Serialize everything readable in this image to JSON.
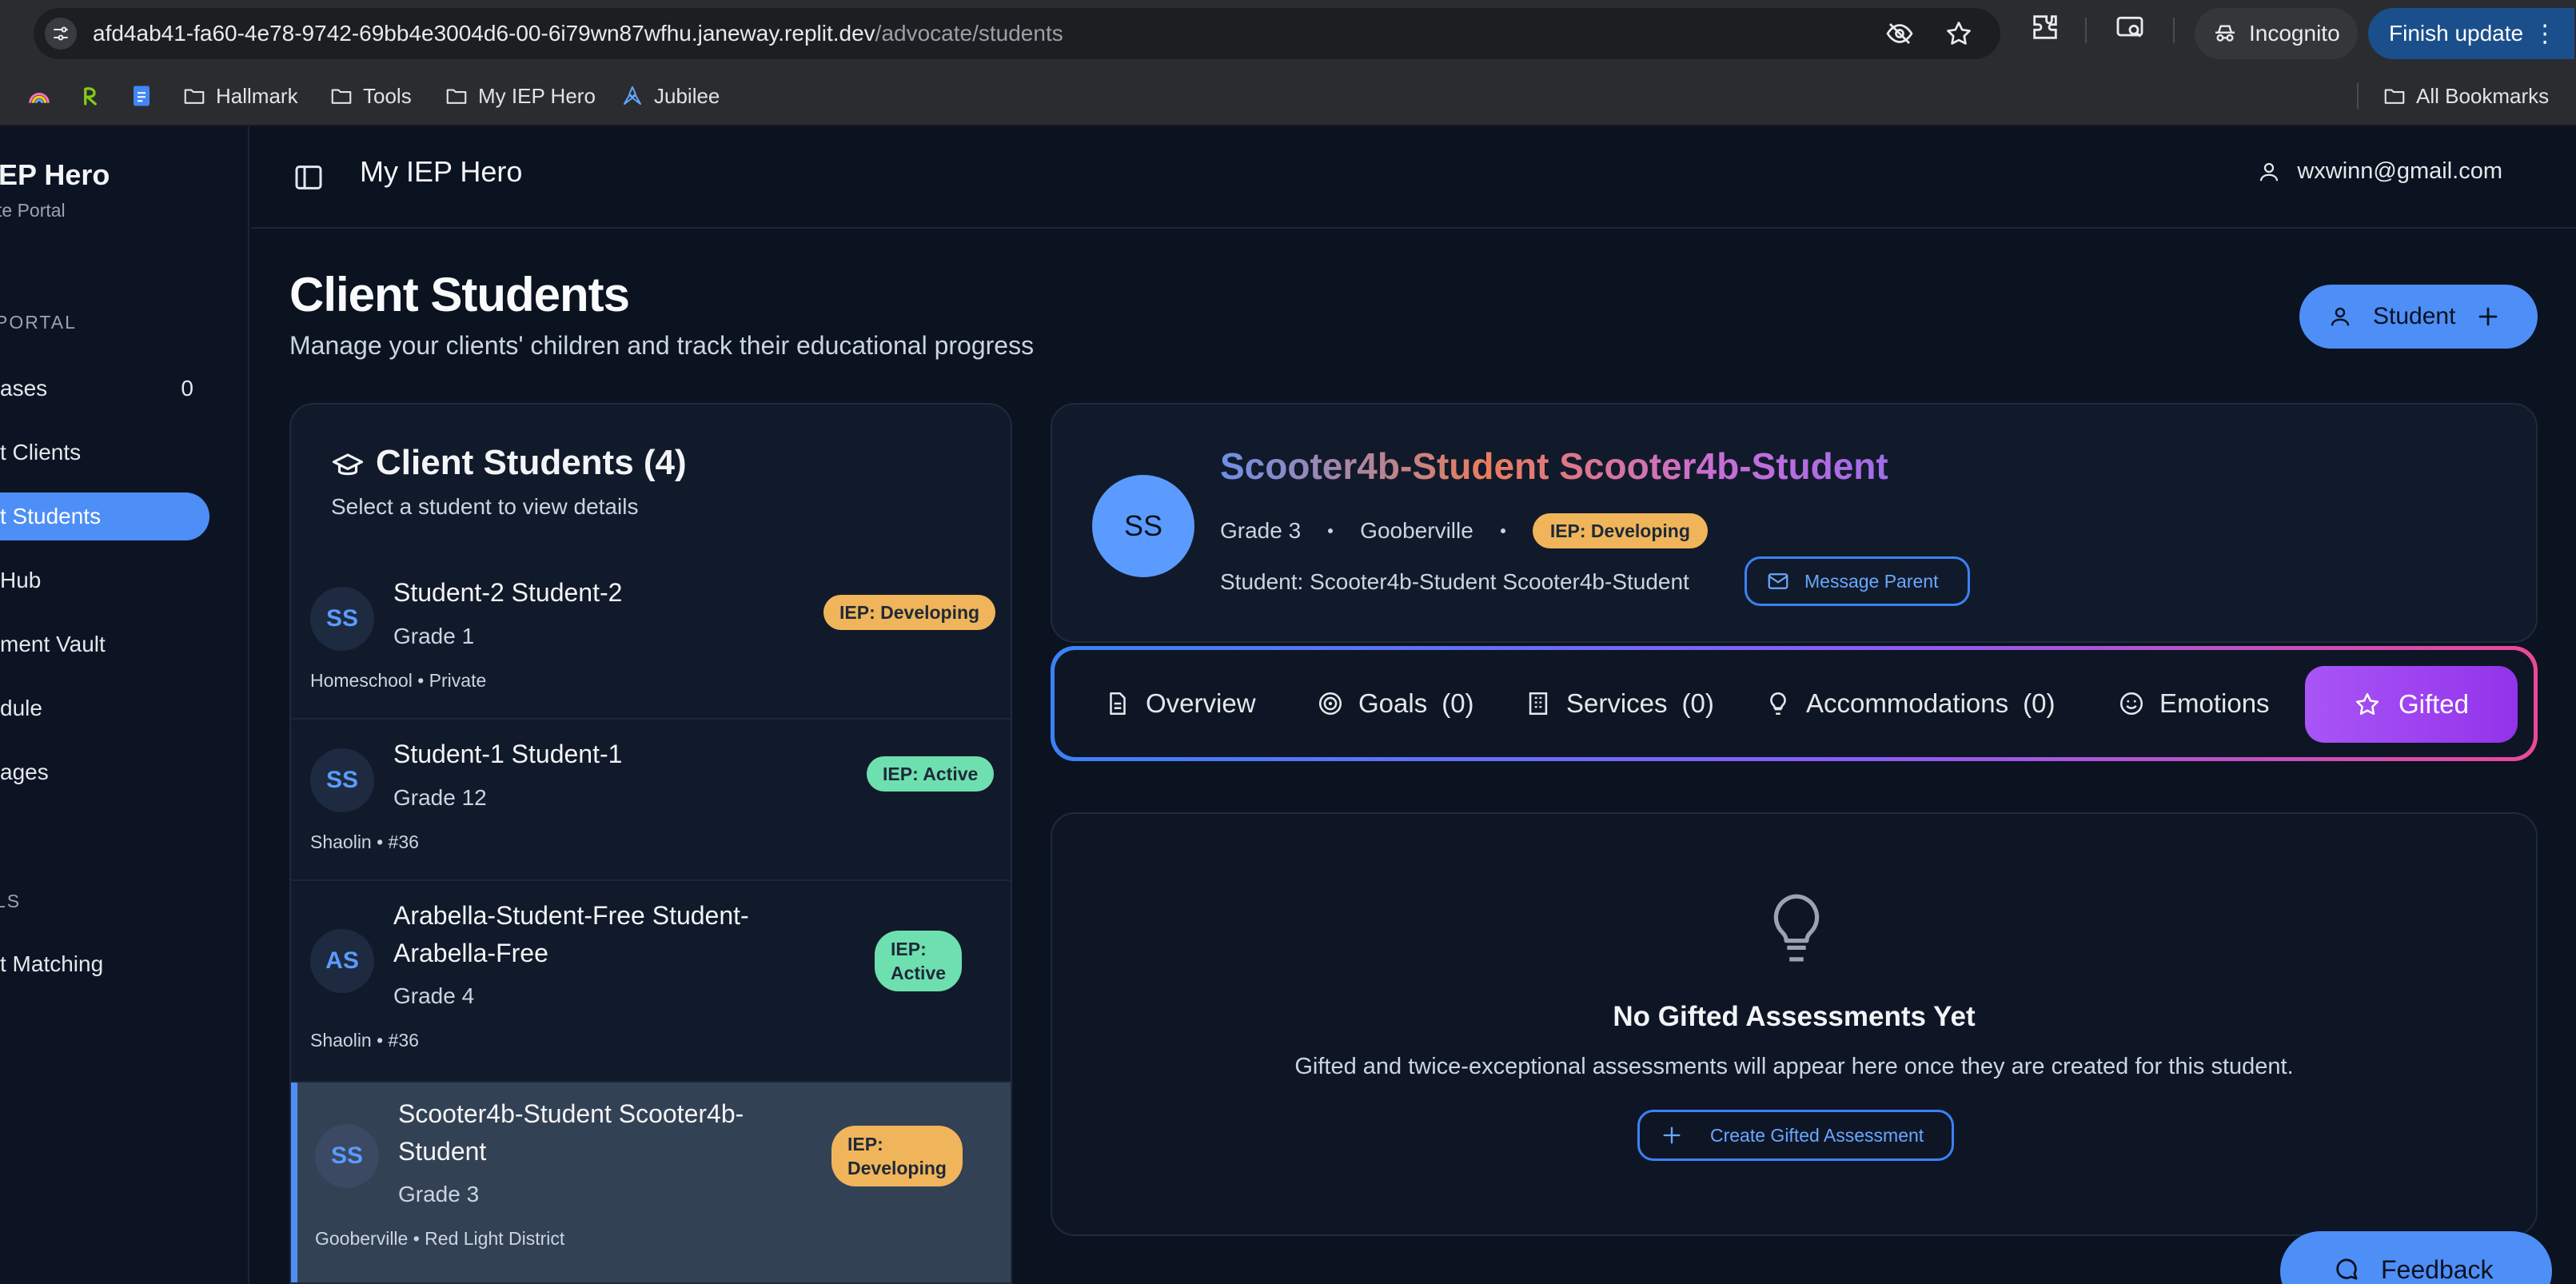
{
  "browser": {
    "url_host": "afd4ab41-fa60-4e78-9742-69bb4e3004d6-00-6i79wn87wfhu.janeway.replit.dev",
    "url_path": "/advocate/students",
    "incognito_label": "Incognito",
    "finish_update_label": "Finish update",
    "bookmarks": [
      "Hallmark",
      "Tools",
      "My IEP Hero",
      "Jubilee"
    ],
    "all_bookmarks_label": "All Bookmarks"
  },
  "sidebar": {
    "brand_title": "IEP Hero",
    "brand_subtitle": "te Portal",
    "section_portal": "PORTAL",
    "section_tools": "LS",
    "items": [
      {
        "label": "ases",
        "count": "0"
      },
      {
        "label": "t Clients"
      },
      {
        "label": "t Students"
      },
      {
        "label": " Hub"
      },
      {
        "label": "ment Vault"
      },
      {
        "label": "dule"
      },
      {
        "label": "ages"
      },
      {
        "label": "t Matching"
      }
    ]
  },
  "header": {
    "title": "My IEP Hero",
    "user_email": "wxwinn@gmail.com"
  },
  "page": {
    "title": "Client Students",
    "subtitle": "Manage your clients' children and track their educational progress",
    "add_student_label": "Student"
  },
  "student_list": {
    "title": "Client Students (4)",
    "subtitle": "Select a student to view details",
    "students": [
      {
        "initials": "SS",
        "name": "Student-2 Student-2",
        "grade": "Grade 1",
        "meta": "Homeschool • Private",
        "badge": "IEP: Developing",
        "badge_color": "#f0b55a"
      },
      {
        "initials": "SS",
        "name": "Student-1 Student-1",
        "grade": "Grade 12",
        "meta": "Shaolin • #36",
        "badge": "IEP: Active",
        "badge_color": "#6ee0b0"
      },
      {
        "initials": "AS",
        "name_line1": "Arabella-Student-Free Student-",
        "name_line2": "Arabella-Free",
        "grade": "Grade 4",
        "meta": "Shaolin • #36",
        "badge_line1": "IEP:",
        "badge_line2": "Active",
        "badge_color": "#6ee0b0"
      },
      {
        "initials": "SS",
        "name_line1": "Scooter4b-Student Scooter4b-",
        "name_line2": "Student",
        "grade": "Grade 3",
        "meta": "Gooberville • Red Light District",
        "badge_line1": "IEP:",
        "badge_line2": "Developing",
        "badge_color": "#f0b55a",
        "selected": true
      }
    ]
  },
  "profile": {
    "initials": "SS",
    "name": "Scooter4b-Student Scooter4b-Student",
    "grade": "Grade 3",
    "location": "Gooberville",
    "badge": "IEP: Developing",
    "student_line": "Student: Scooter4b-Student Scooter4b-Student",
    "message_parent_label": "Message Parent"
  },
  "tabs": [
    {
      "label": "Overview",
      "icon": "document-icon"
    },
    {
      "label": "Goals",
      "count": "(0)",
      "icon": "target-icon"
    },
    {
      "label": "Services",
      "count": "(0)",
      "icon": "building-icon"
    },
    {
      "label": "Accommodations",
      "count": "(0)",
      "icon": "lightbulb-icon"
    },
    {
      "label": "Emotions",
      "icon": "smile-icon"
    },
    {
      "label": "Gifted",
      "icon": "star-icon",
      "active": true
    }
  ],
  "empty_state": {
    "title": "No Gifted Assessments Yet",
    "text": "Gifted and twice-exceptional assessments will appear here once they are created for this student.",
    "button_label": "Create Gifted Assessment"
  },
  "feedback_label": "Feedback",
  "colors": {
    "accent": "#4e8ef7",
    "developing": "#f0b55a",
    "active": "#6ee0b0",
    "gifted": "#a855f7"
  }
}
